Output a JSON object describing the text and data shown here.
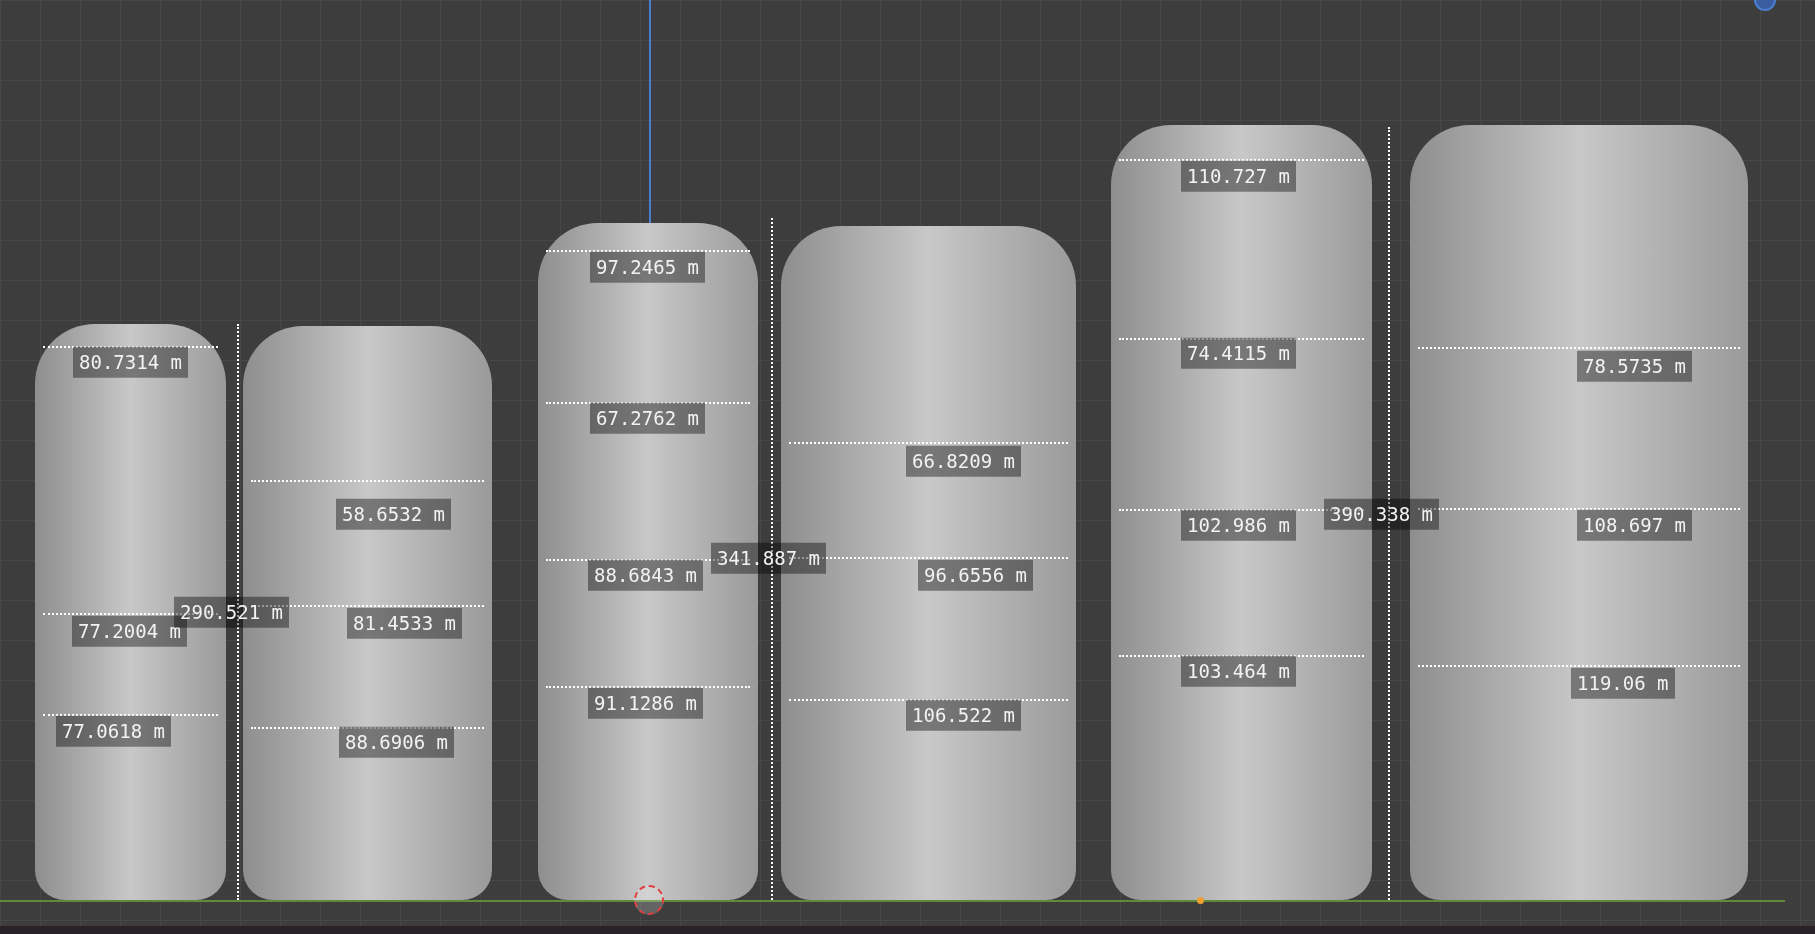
{
  "viewport": {
    "models": [
      {
        "height_label": "290.521 m",
        "measurements": [
          "80.7314 m",
          "77.2004 m",
          "77.0618 m"
        ]
      },
      {
        "measurements": [
          "58.6532 m",
          "81.4533 m",
          "88.6906 m"
        ]
      },
      {
        "height_label": "341.887 m",
        "measurements": [
          "97.2465 m",
          "67.2762 m",
          "88.6843 m",
          "91.1286 m"
        ]
      },
      {
        "measurements": [
          "66.8209 m",
          "96.6556 m",
          "106.522 m"
        ]
      },
      {
        "height_label": "390.338 m",
        "measurements": [
          "110.727 m",
          "74.4115 m",
          "102.986 m",
          "103.464 m"
        ]
      },
      {
        "measurements": [
          "78.5735 m",
          "108.697 m",
          "119.06 m"
        ]
      }
    ]
  }
}
